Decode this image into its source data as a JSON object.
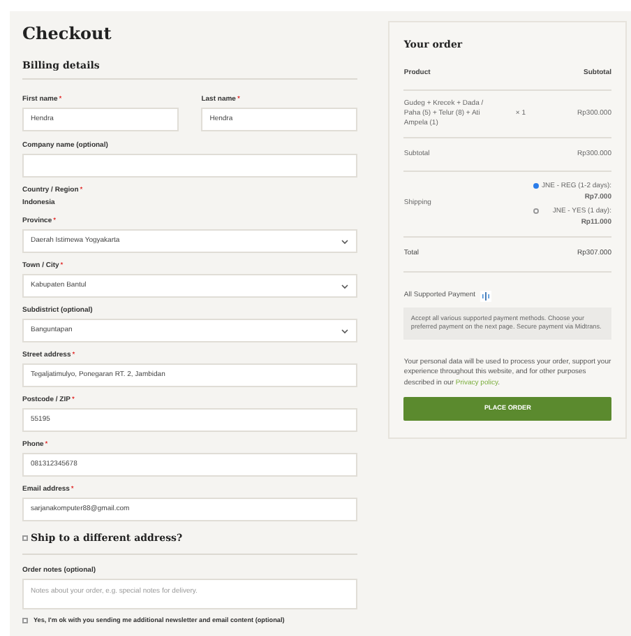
{
  "title": "Checkout",
  "required_mark": "*",
  "billing": {
    "heading": "Billing details",
    "name_row": [
      {
        "label": "First name",
        "required": true,
        "value": "Hendra"
      },
      {
        "label": "Last name",
        "required": true,
        "value": "Hendra"
      }
    ],
    "fields": [
      {
        "kind": "input",
        "label": "Company name (optional)",
        "required": false
      },
      {
        "kind": "static",
        "label": "Country / Region",
        "required": true,
        "value": "Indonesia"
      },
      {
        "kind": "select",
        "label": "Province",
        "required": true,
        "value": "Daerah Istimewa Yogyakarta"
      },
      {
        "kind": "select",
        "label": "Town / City",
        "required": true,
        "value": "Kabupaten Bantul"
      },
      {
        "kind": "select",
        "label": "Subdistrict (optional)",
        "required": false,
        "value": "Banguntapan"
      },
      {
        "kind": "input",
        "label": "Street address",
        "required": true,
        "value": "Tegaljatimulyo, Ponegaran RT. 2, Jambidan"
      },
      {
        "kind": "input",
        "label": "Postcode / ZIP",
        "required": true,
        "value": "55195"
      },
      {
        "kind": "input",
        "label": "Phone",
        "required": true,
        "value": "081312345678"
      },
      {
        "kind": "input",
        "label": "Email address",
        "required": true,
        "value": "sarjanakomputer88@gmail.com"
      }
    ]
  },
  "ship_different": {
    "label": "Ship to a different address?",
    "checked": false
  },
  "order_notes": {
    "label": "Order notes (optional)",
    "placeholder": "Notes about your order, e.g. special notes for delivery."
  },
  "newsletter": {
    "label": "Yes, I'm ok with you sending me additional newsletter and email content (optional)",
    "checked": false
  },
  "order": {
    "heading": "Your order",
    "columns": [
      "Product",
      "Subtotal"
    ],
    "item": {
      "name": "Gudeg + Krecek + Dada / Paha (5) + Telur (8) + Ati Ampela (1)",
      "qty": "× 1",
      "price": "Rp300.000"
    },
    "subtotal": {
      "label": "Subtotal",
      "value": "Rp300.000"
    },
    "shipping": {
      "label": "Shipping",
      "options": [
        {
          "text": "JNE - REG (1-2 days): **Rp7.000**",
          "selected": true
        },
        {
          "text": "JNE - YES (1 day): **Rp11.000**",
          "selected": false
        }
      ]
    },
    "total": {
      "label": "Total",
      "value": "Rp307.000"
    }
  },
  "payment": {
    "label": "All Supported Payment",
    "description": "Accept all various supported payment methods. Choose your preferred payment on the next page. Secure payment via Midtrans."
  },
  "privacy": {
    "text": "Your personal data will be used to process your order, support your experience throughout this website, and for other purposes described in our",
    "link": "Privacy policy",
    "end": "."
  },
  "place_order": "PLACE ORDER"
}
